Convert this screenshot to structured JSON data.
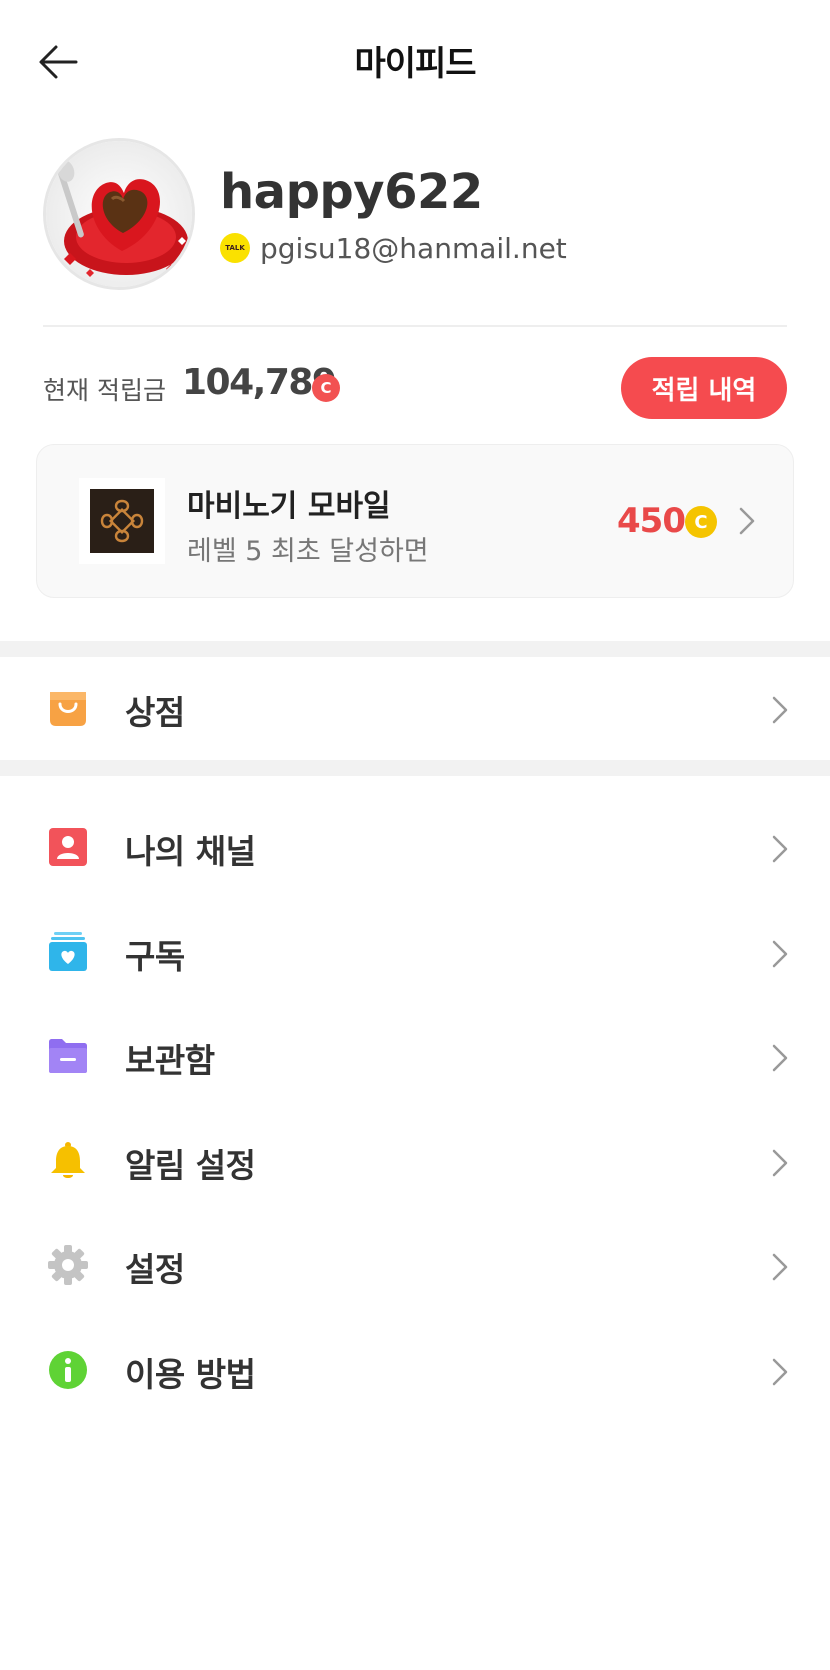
{
  "header": {
    "title": "마이피드"
  },
  "profile": {
    "username": "happy622",
    "talk_badge": "TALK",
    "email": "pgisu18@hanmail.net"
  },
  "points": {
    "label": "현재 적립금",
    "value": "104,789",
    "coin_symbol": "C",
    "history_button": "적립 내역"
  },
  "promo": {
    "game_logo_text": "MABINOGI MOBILE",
    "title": "마비노기 모바일",
    "subtitle": "레벨 5 최초 달성하면",
    "reward": "450",
    "coin_symbol": "C"
  },
  "menu": {
    "shop": {
      "label": "상점",
      "icon": "shopping-bag-icon"
    },
    "items": [
      {
        "label": "나의 채널",
        "icon": "profile-card-icon"
      },
      {
        "label": "구독",
        "icon": "subscription-icon"
      },
      {
        "label": "보관함",
        "icon": "folder-icon"
      },
      {
        "label": "알림 설정",
        "icon": "bell-icon"
      },
      {
        "label": "설정",
        "icon": "gear-icon"
      },
      {
        "label": "이용 방법",
        "icon": "info-icon"
      }
    ]
  },
  "colors": {
    "accent": "#f54b4f",
    "reward": "#e94949",
    "coin_yellow": "#f5c400",
    "talk_yellow": "#fae100"
  }
}
